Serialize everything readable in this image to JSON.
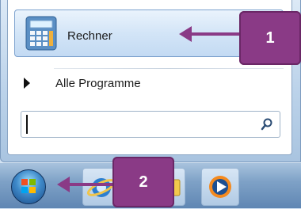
{
  "start_menu": {
    "pinned_program": {
      "label": "Rechner",
      "icon": "calculator-icon"
    },
    "all_programs": {
      "label": "Alle Programme",
      "icon": "arrow-right-icon"
    },
    "search": {
      "value": "",
      "placeholder": "",
      "icon": "search-icon"
    }
  },
  "taskbar": {
    "start_button": {
      "icon": "windows-start-orb-icon"
    },
    "pinned": [
      {
        "icon": "internet-explorer-icon"
      },
      {
        "icon": "windows-explorer-icon"
      },
      {
        "icon": "windows-media-player-icon"
      }
    ]
  },
  "callouts": [
    {
      "number": "1",
      "target": "Rechner"
    },
    {
      "number": "2",
      "target": "start button"
    }
  ],
  "colors": {
    "callout": "#8a3a86",
    "selection_border": "#7da2ce",
    "taskbar": "#6f95bf"
  }
}
